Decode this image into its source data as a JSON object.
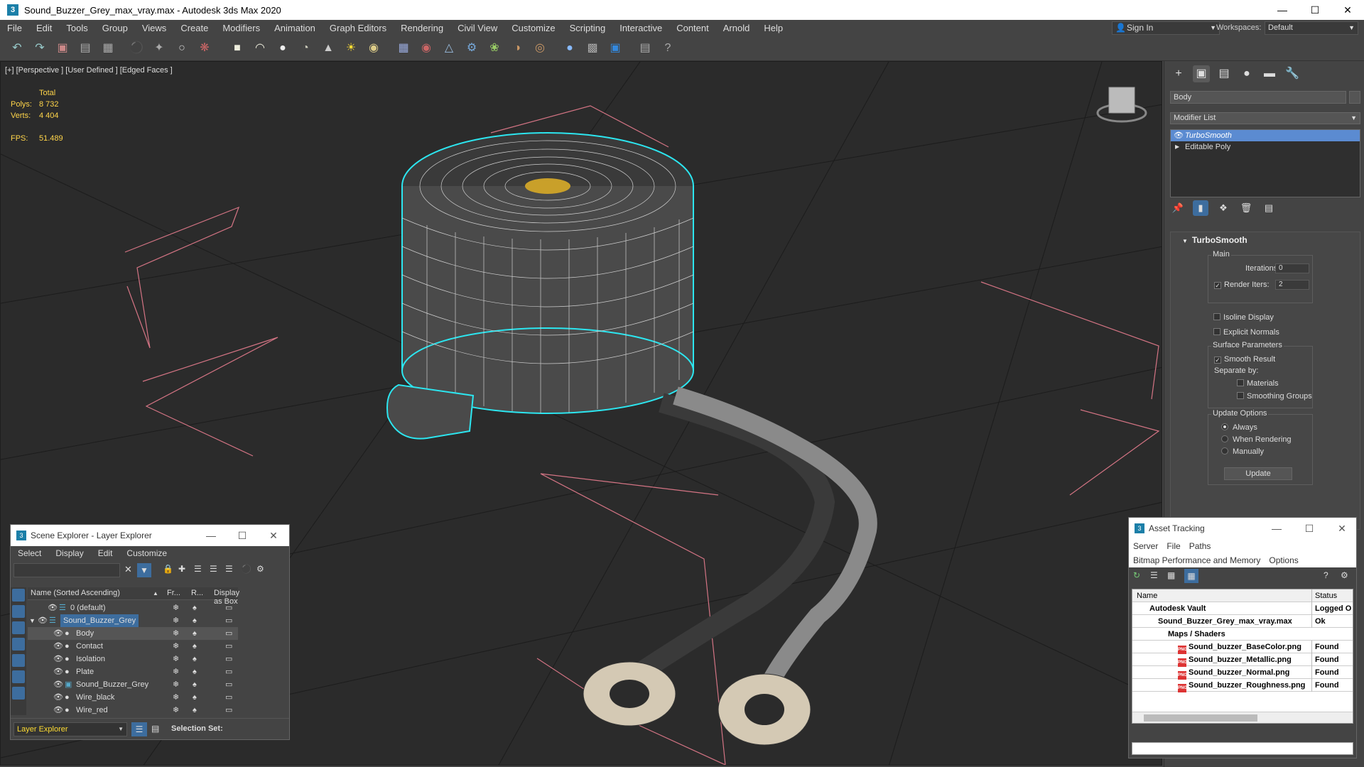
{
  "window": {
    "title": "Sound_Buzzer_Grey_max_vray.max - Autodesk 3ds Max 2020",
    "icon": "3ds-max-icon"
  },
  "menu": [
    "File",
    "Edit",
    "Tools",
    "Group",
    "Views",
    "Create",
    "Modifiers",
    "Animation",
    "Graph Editors",
    "Rendering",
    "Civil View",
    "Customize",
    "Scripting",
    "Interactive",
    "Content",
    "Arnold",
    "Help"
  ],
  "signin": {
    "label": "Sign In"
  },
  "workspaces": {
    "label": "Workspaces:",
    "value": "Default"
  },
  "viewport": {
    "label": "[+] [Perspective ] [User Defined ] [Edged Faces ]",
    "stats": {
      "header": "Total",
      "polys_label": "Polys:",
      "polys": "8 732",
      "verts_label": "Verts:",
      "verts": "4 404",
      "fps_label": "FPS:",
      "fps": "51.489"
    }
  },
  "command_panel": {
    "object_name": "Body",
    "modifier_list": "Modifier List",
    "stack": [
      "TurboSmooth",
      "Editable Poly"
    ],
    "rollout_title": "TurboSmooth",
    "main_label": "Main",
    "iterations_label": "Iterations:",
    "iterations": "0",
    "render_iters_label": "Render Iters:",
    "render_iters": "2",
    "isoline": "Isoline Display",
    "explicit": "Explicit Normals",
    "surface_params": "Surface Parameters",
    "smooth_result": "Smooth Result",
    "separate_by": "Separate by:",
    "materials": "Materials",
    "smoothing_groups": "Smoothing Groups",
    "update_options": "Update Options",
    "always": "Always",
    "when_rendering": "When Rendering",
    "manually": "Manually",
    "update_btn": "Update"
  },
  "scene_explorer": {
    "title": "Scene Explorer - Layer Explorer",
    "menu": [
      "Select",
      "Display",
      "Edit",
      "Customize"
    ],
    "columns": {
      "name": "Name (Sorted Ascending)",
      "fr": "Fr...",
      "r": "R...",
      "box": "Display as Box"
    },
    "rows": [
      "0 (default)",
      "Sound_Buzzer_Grey",
      "Body",
      "Contact",
      "Isolation",
      "Plate",
      "Sound_Buzzer_Grey",
      "Wire_black",
      "Wire_red"
    ],
    "footer_layer": "Layer Explorer",
    "selection_set": "Selection Set:"
  },
  "asset_tracking": {
    "title": "Asset Tracking",
    "menu1": [
      "Server",
      "File",
      "Paths"
    ],
    "menu2": [
      "Bitmap Performance and Memory",
      "Options"
    ],
    "col_name": "Name",
    "col_status": "Status",
    "rows": [
      {
        "name": "Autodesk Vault",
        "status": "Logged O"
      },
      {
        "name": "Sound_Buzzer_Grey_max_vray.max",
        "status": "Ok"
      },
      {
        "name": "Maps / Shaders",
        "status": ""
      },
      {
        "name": "Sound_buzzer_BaseColor.png",
        "status": "Found"
      },
      {
        "name": "Sound_buzzer_Metallic.png",
        "status": "Found"
      },
      {
        "name": "Sound_buzzer_Normal.png",
        "status": "Found"
      },
      {
        "name": "Sound_buzzer_Roughness.png",
        "status": "Found"
      }
    ]
  }
}
